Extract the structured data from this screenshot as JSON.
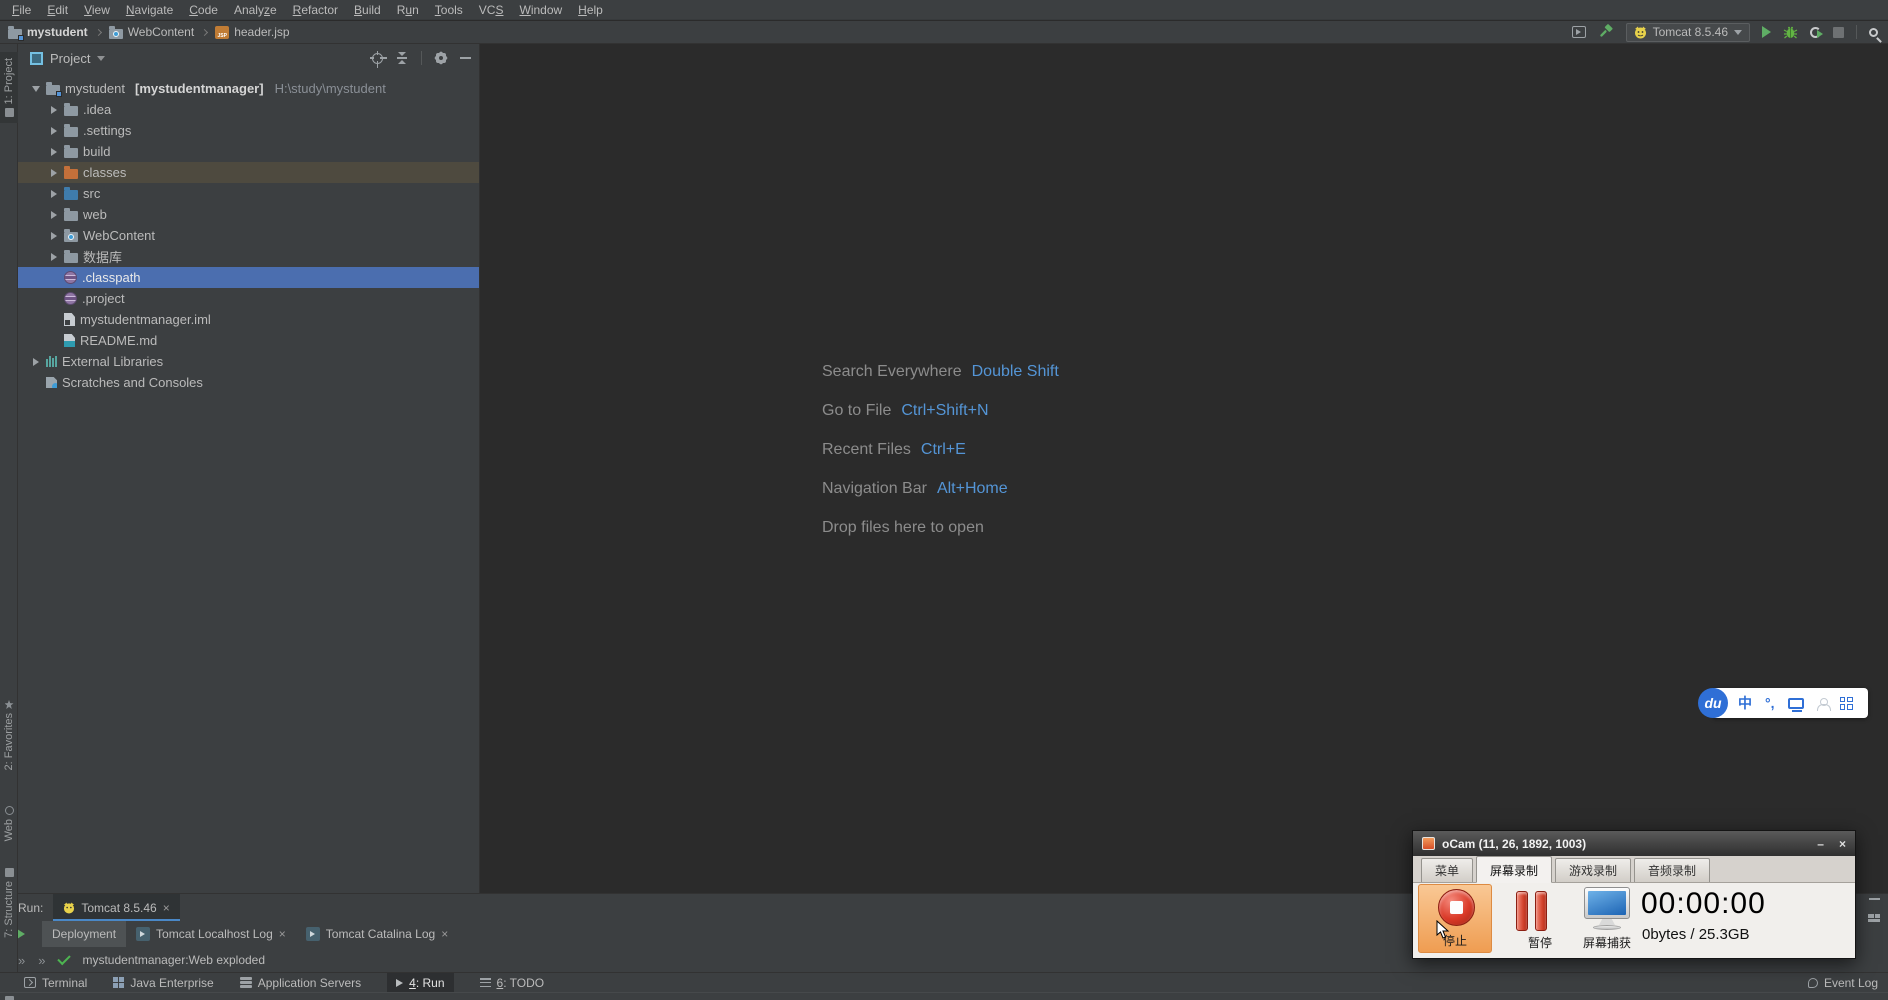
{
  "colors": {
    "panel_bg": "#3c3f41",
    "editor_bg": "#2b2b2b",
    "selection_blue": "#4b6eaf",
    "accent_blue": "#5495d6",
    "ide_green": "#5fad65",
    "record_red": "#da3a28",
    "baidu_blue": "#2f6fd6",
    "ocam_hover_orange": "#f0a55c"
  },
  "menubar": {
    "items": [
      {
        "pre": "",
        "key": "F",
        "post": "ile"
      },
      {
        "pre": "",
        "key": "E",
        "post": "dit"
      },
      {
        "pre": "",
        "key": "V",
        "post": "iew"
      },
      {
        "pre": "",
        "key": "N",
        "post": "avigate"
      },
      {
        "pre": "",
        "key": "C",
        "post": "ode"
      },
      {
        "pre": "Analy",
        "key": "z",
        "post": "e"
      },
      {
        "pre": "",
        "key": "R",
        "post": "efactor"
      },
      {
        "pre": "",
        "key": "B",
        "post": "uild"
      },
      {
        "pre": "R",
        "key": "u",
        "post": "n"
      },
      {
        "pre": "",
        "key": "T",
        "post": "ools"
      },
      {
        "pre": "VC",
        "key": "S",
        "post": ""
      },
      {
        "pre": "",
        "key": "W",
        "post": "indow"
      },
      {
        "pre": "",
        "key": "H",
        "post": "elp"
      }
    ]
  },
  "breadcrumb": {
    "project": "mystudent",
    "folder": "WebContent",
    "file": "header.jsp",
    "file_badge": "JSP"
  },
  "toolbar": {
    "run_config": "Tomcat 8.5.46"
  },
  "ui": {
    "close": "×",
    "minimize": "–"
  },
  "left_strip": {
    "project": "1: Project",
    "favorites": "2: Favorites",
    "web": "Web",
    "structure": "7: Structure"
  },
  "project_panel": {
    "title": "Project",
    "tree": [
      {
        "name": "mystudent",
        "module": "[mystudentmanager]",
        "path": "H:\\study\\mystudent"
      },
      {
        "label": ".idea"
      },
      {
        "label": ".settings"
      },
      {
        "label": "build"
      },
      {
        "label": "classes"
      },
      {
        "label": "src"
      },
      {
        "label": "web"
      },
      {
        "label": "WebContent"
      },
      {
        "label": "数据库"
      },
      {
        "label": ".classpath"
      },
      {
        "label": ".project"
      },
      {
        "label": "mystudentmanager.iml"
      },
      {
        "label": "README.md"
      },
      {
        "label": "External Libraries"
      },
      {
        "label": "Scratches and Consoles"
      }
    ]
  },
  "editor": {
    "shortcuts": [
      {
        "label": "Search Everywhere",
        "keys": "Double Shift"
      },
      {
        "label": "Go to File",
        "keys": "Ctrl+Shift+N"
      },
      {
        "label": "Recent Files",
        "keys": "Ctrl+E"
      },
      {
        "label": "Navigation Bar",
        "keys": "Alt+Home"
      }
    ],
    "drop_hint": "Drop files here to open"
  },
  "ime": {
    "logo": "du",
    "mode": "中",
    "punct": "°,"
  },
  "run_panel": {
    "label": "Run:",
    "config_tab": "Tomcat 8.5.46",
    "tabs": [
      "Deployment",
      "Tomcat Localhost Log",
      "Tomcat Catalina Log"
    ],
    "chevron": "»",
    "message": "mystudentmanager:Web exploded"
  },
  "status_bar": {
    "terminal": "Terminal",
    "java_enterprise": "Java Enterprise",
    "app_servers": "Application Servers",
    "run": {
      "pre": "",
      "key": "4",
      "post": ": Run"
    },
    "todo": {
      "pre": "",
      "key": "6",
      "post": ": TODO"
    },
    "event_log": "Event Log"
  },
  "ocam": {
    "title": "oCam (11, 26, 1892, 1003)",
    "tabs": [
      "菜单",
      "屏幕录制",
      "游戏录制",
      "音频录制"
    ],
    "stop": "停止",
    "pause": "暂停",
    "capture": "屏幕捕获",
    "timer": "00:00:00",
    "size_info": "0bytes / 25.3GB"
  }
}
